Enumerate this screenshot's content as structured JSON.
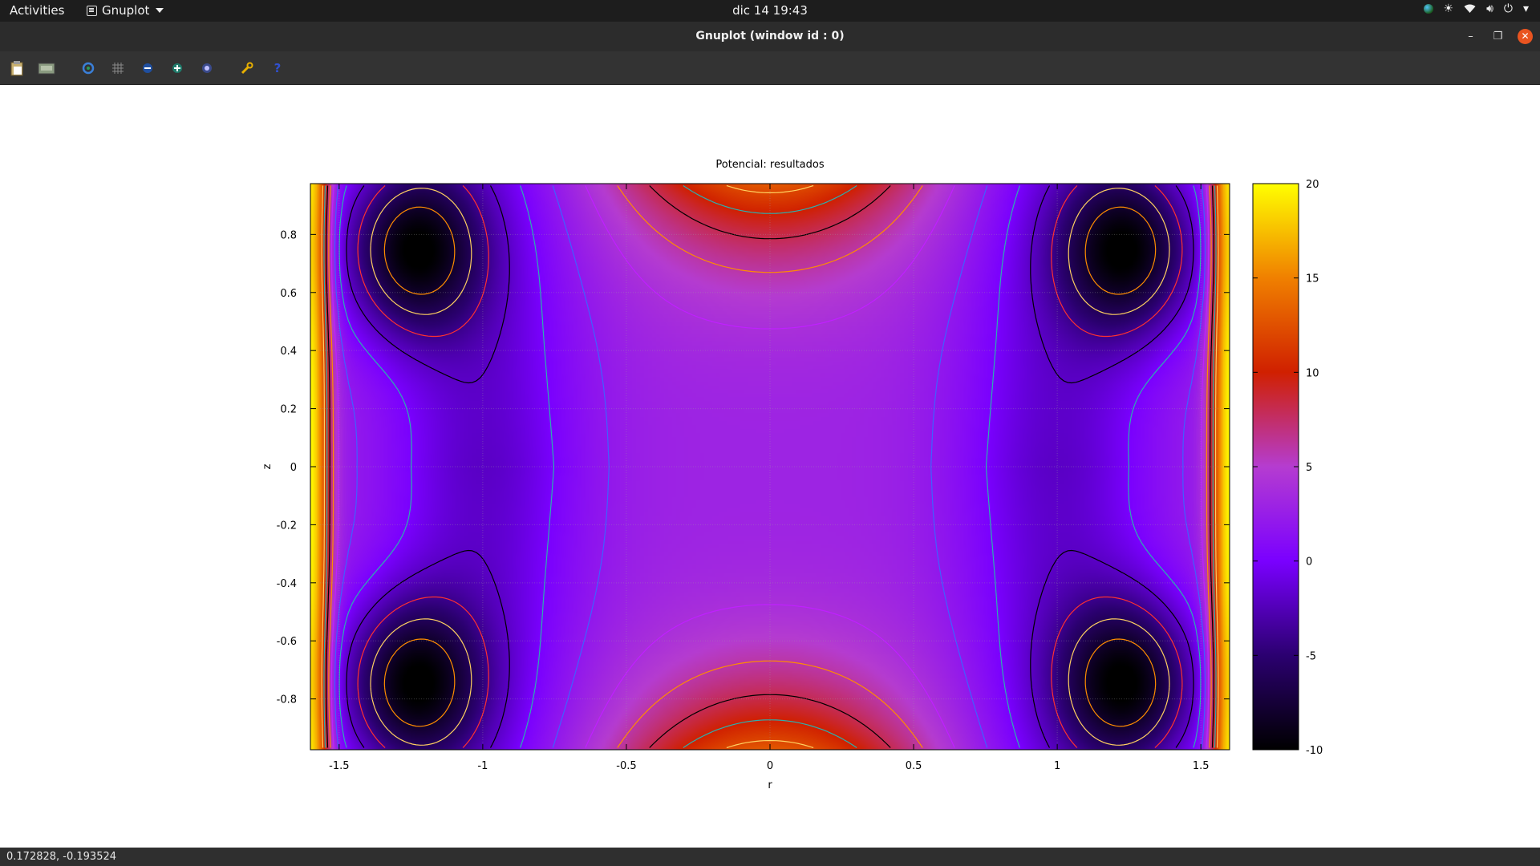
{
  "topbar": {
    "activities": "Activities",
    "app_name": "Gnuplot",
    "clock": "dic 14  19:43",
    "tray_icons": [
      "globe-icon",
      "brightness-icon",
      "wifi-icon",
      "volume-icon",
      "power-icon",
      "chevron-down-icon"
    ]
  },
  "window": {
    "title": "Gnuplot (window id : 0)",
    "buttons": [
      "minimize",
      "maximize",
      "close"
    ],
    "close_color": "#e95420"
  },
  "toolbar": {
    "icons": [
      "clipboard-icon",
      "print-icon",
      "replot-icon",
      "grid-icon",
      "previous-zoom-icon",
      "next-zoom-icon",
      "autoscale-icon",
      "config-icon",
      "help-icon"
    ]
  },
  "statusbar": {
    "coords": "0.172828, -0.193524"
  },
  "chart_data": {
    "type": "heatmap",
    "title": "Potencial: resultados",
    "xlabel": "r",
    "ylabel": "z",
    "xlim": [
      -1.6,
      1.6
    ],
    "ylim": [
      -0.975,
      0.975
    ],
    "xticks": [
      "-1.5",
      "-1",
      "-0.5",
      "0",
      "0.5",
      "1",
      "1.5"
    ],
    "xtick_values": [
      -1.5,
      -1,
      -0.5,
      0,
      0.5,
      1,
      1.5
    ],
    "yticks": [
      "-0.8",
      "-0.6",
      "-0.4",
      "-0.2",
      "0",
      "0.2",
      "0.4",
      "0.6",
      "0.8"
    ],
    "ytick_values": [
      -0.8,
      -0.6,
      -0.4,
      -0.2,
      0,
      0.2,
      0.4,
      0.6,
      0.8
    ],
    "colorbar": {
      "range": [
        -10,
        20
      ],
      "ticks": [
        "20",
        "15",
        "10",
        "5",
        "0",
        "-5",
        "-10"
      ],
      "tick_values": [
        20,
        15,
        10,
        5,
        0,
        -5,
        -10
      ],
      "palette": [
        "#000000",
        "#2b0070",
        "#7a00ff",
        "#b53cd0",
        "#d02000",
        "#f08000",
        "#ffff00"
      ]
    },
    "field_features": {
      "center_value": 3,
      "top_bottom_max": 13,
      "edge_max": 20,
      "trough_min": -8,
      "trough_r": 1.25,
      "trough_z": 0.75
    },
    "contour_levels": [
      -8,
      -6,
      -4,
      -2,
      0,
      2,
      4,
      6,
      8,
      10,
      12
    ],
    "contour_colors": [
      "#ff8c00",
      "#ffd060",
      "#ff3030",
      "#000000",
      "#2ab0b0",
      "#4060ff",
      "#c020ff",
      "#ff8c00",
      "#000000",
      "#2ab0b0",
      "#ffd060"
    ]
  }
}
